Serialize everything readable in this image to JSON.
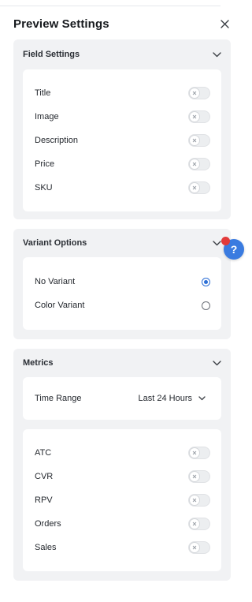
{
  "header": {
    "title": "Preview Settings",
    "close_icon": "close-icon"
  },
  "field_settings": {
    "title": "Field Settings",
    "items": [
      {
        "label": "Title",
        "enabled": false
      },
      {
        "label": "Image",
        "enabled": false
      },
      {
        "label": "Description",
        "enabled": false
      },
      {
        "label": "Price",
        "enabled": false
      },
      {
        "label": "SKU",
        "enabled": false
      }
    ]
  },
  "variant_options": {
    "title": "Variant Options",
    "options": [
      {
        "label": "No Variant",
        "selected": true
      },
      {
        "label": "Color Variant",
        "selected": false
      }
    ]
  },
  "metrics": {
    "title": "Metrics",
    "time_range_label": "Time Range",
    "time_range_value": "Last 24 Hours",
    "items": [
      {
        "label": "ATC",
        "enabled": false
      },
      {
        "label": "CVR",
        "enabled": false
      },
      {
        "label": "RPV",
        "enabled": false
      },
      {
        "label": "Orders",
        "enabled": false
      },
      {
        "label": "Sales",
        "enabled": false
      }
    ]
  },
  "help": {
    "glyph": "?",
    "icon": "help-icon"
  },
  "colors": {
    "accent": "#3a7be0",
    "radio": "#2d6fd6",
    "notification": "#e23a3a",
    "section_bg": "#f1f2f4"
  }
}
